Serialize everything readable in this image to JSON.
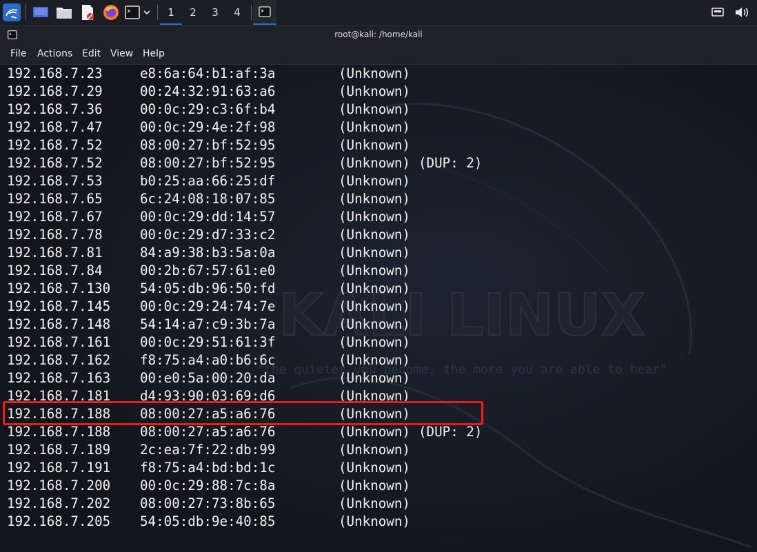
{
  "panel": {
    "workspaces": [
      "1",
      "2",
      "3",
      "4"
    ],
    "active_workspace": "1"
  },
  "window": {
    "title": "root@kali: /home/kali"
  },
  "menu": [
    "File",
    "Actions",
    "Edit",
    "View",
    "Help"
  ],
  "wallpaper": {
    "logo_text": "KALI LINUX",
    "tagline": "\"the quieter you become, the more you are able to hear\""
  },
  "terminal": {
    "rows": [
      {
        "ip": "192.168.7.23",
        "mac": "e8:6a:64:b1:af:3a",
        "vendor": "(Unknown)",
        "dup": ""
      },
      {
        "ip": "192.168.7.29",
        "mac": "00:24:32:91:63:a6",
        "vendor": "(Unknown)",
        "dup": ""
      },
      {
        "ip": "192.168.7.36",
        "mac": "00:0c:29:c3:6f:b4",
        "vendor": "(Unknown)",
        "dup": ""
      },
      {
        "ip": "192.168.7.47",
        "mac": "00:0c:29:4e:2f:98",
        "vendor": "(Unknown)",
        "dup": ""
      },
      {
        "ip": "192.168.7.52",
        "mac": "08:00:27:bf:52:95",
        "vendor": "(Unknown)",
        "dup": ""
      },
      {
        "ip": "192.168.7.52",
        "mac": "08:00:27:bf:52:95",
        "vendor": "(Unknown)",
        "dup": "(DUP: 2)"
      },
      {
        "ip": "192.168.7.53",
        "mac": "b0:25:aa:66:25:df",
        "vendor": "(Unknown)",
        "dup": ""
      },
      {
        "ip": "192.168.7.65",
        "mac": "6c:24:08:18:07:85",
        "vendor": "(Unknown)",
        "dup": ""
      },
      {
        "ip": "192.168.7.67",
        "mac": "00:0c:29:dd:14:57",
        "vendor": "(Unknown)",
        "dup": ""
      },
      {
        "ip": "192.168.7.78",
        "mac": "00:0c:29:d7:33:c2",
        "vendor": "(Unknown)",
        "dup": ""
      },
      {
        "ip": "192.168.7.81",
        "mac": "84:a9:38:b3:5a:0a",
        "vendor": "(Unknown)",
        "dup": ""
      },
      {
        "ip": "192.168.7.84",
        "mac": "00:2b:67:57:61:e0",
        "vendor": "(Unknown)",
        "dup": ""
      },
      {
        "ip": "192.168.7.130",
        "mac": "54:05:db:96:50:fd",
        "vendor": "(Unknown)",
        "dup": ""
      },
      {
        "ip": "192.168.7.145",
        "mac": "00:0c:29:24:74:7e",
        "vendor": "(Unknown)",
        "dup": ""
      },
      {
        "ip": "192.168.7.148",
        "mac": "54:14:a7:c9:3b:7a",
        "vendor": "(Unknown)",
        "dup": ""
      },
      {
        "ip": "192.168.7.161",
        "mac": "00:0c:29:51:61:3f",
        "vendor": "(Unknown)",
        "dup": ""
      },
      {
        "ip": "192.168.7.162",
        "mac": "f8:75:a4:a0:b6:6c",
        "vendor": "(Unknown)",
        "dup": ""
      },
      {
        "ip": "192.168.7.163",
        "mac": "00:e0:5a:00:20:da",
        "vendor": "(Unknown)",
        "dup": ""
      },
      {
        "ip": "192.168.7.181",
        "mac": "d4:93:90:03:69:d6",
        "vendor": "(Unknown)",
        "dup": ""
      },
      {
        "ip": "192.168.7.188",
        "mac": "08:00:27:a5:a6:76",
        "vendor": "(Unknown)",
        "dup": ""
      },
      {
        "ip": "192.168.7.188",
        "mac": "08:00:27:a5:a6:76",
        "vendor": "(Unknown)",
        "dup": "(DUP: 2)"
      },
      {
        "ip": "192.168.7.189",
        "mac": "2c:ea:7f:22:db:99",
        "vendor": "(Unknown)",
        "dup": ""
      },
      {
        "ip": "192.168.7.191",
        "mac": "f8:75:a4:bd:bd:1c",
        "vendor": "(Unknown)",
        "dup": ""
      },
      {
        "ip": "192.168.7.200",
        "mac": "00:0c:29:88:7c:8a",
        "vendor": "(Unknown)",
        "dup": ""
      },
      {
        "ip": "192.168.7.202",
        "mac": "08:00:27:73:8b:65",
        "vendor": "(Unknown)",
        "dup": ""
      },
      {
        "ip": "192.168.7.205",
        "mac": "54:05:db:9e:40:85",
        "vendor": "(Unknown)",
        "dup": ""
      }
    ],
    "highlighted_row": 19
  },
  "colors": {
    "highlight": "#e0201b",
    "accent": "#2d6fc4"
  },
  "icons": {
    "launcher": "kali-menu-icon",
    "show_desktop": "show-desktop-icon",
    "file_manager": "folder-icon",
    "text_editor": "text-editor-icon",
    "browser": "firefox-icon",
    "terminal": "terminal-icon",
    "network": "network-icon",
    "volume": "volume-icon"
  }
}
